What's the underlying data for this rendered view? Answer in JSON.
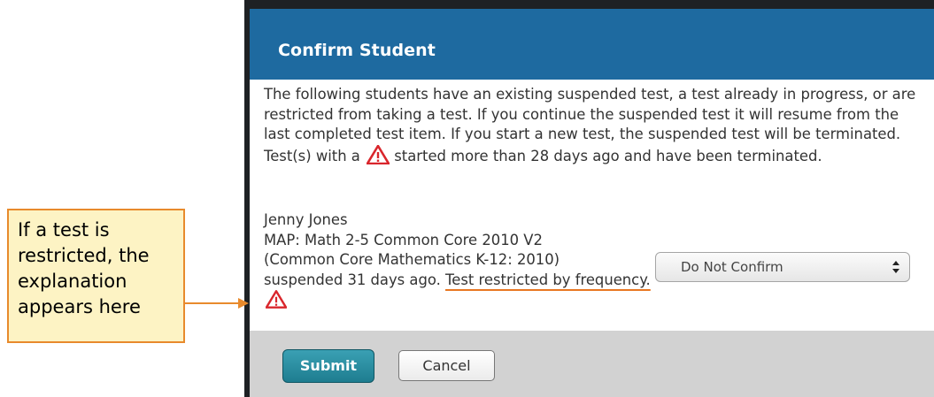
{
  "dialog": {
    "title": "Confirm Student",
    "intro_before_icon": "The following students have an existing suspended test, a test already in progress, or are restricted from taking a test. If you continue the suspended test it will resume from the last completed test item. If you start a new test, the suspended test will be terminated. Test(s) with a ",
    "intro_after_icon": " started more than 28 days ago and have been terminated."
  },
  "student": {
    "name": "Jenny Jones",
    "test_name": "MAP: Math 2-5 Common Core 2010 V2",
    "standard": "(Common Core Mathematics K-12: 2010)",
    "status": "suspended 31 days ago. ",
    "restriction": "Test restricted by frequency."
  },
  "confirm_select": {
    "selected": "Do Not Confirm"
  },
  "footer": {
    "submit_label": "Submit",
    "cancel_label": "Cancel"
  },
  "callout": {
    "text": "If a test is restricted, the explanation appears here"
  },
  "colors": {
    "header": "#1e6aa0",
    "submit": "#2a8fa3",
    "warning": "#d9262c",
    "callout_border": "#e88a2c",
    "callout_fill": "#fdf3c4"
  },
  "icons": {
    "warning": "warning-triangle-icon",
    "select": "up-down-arrows-icon"
  }
}
